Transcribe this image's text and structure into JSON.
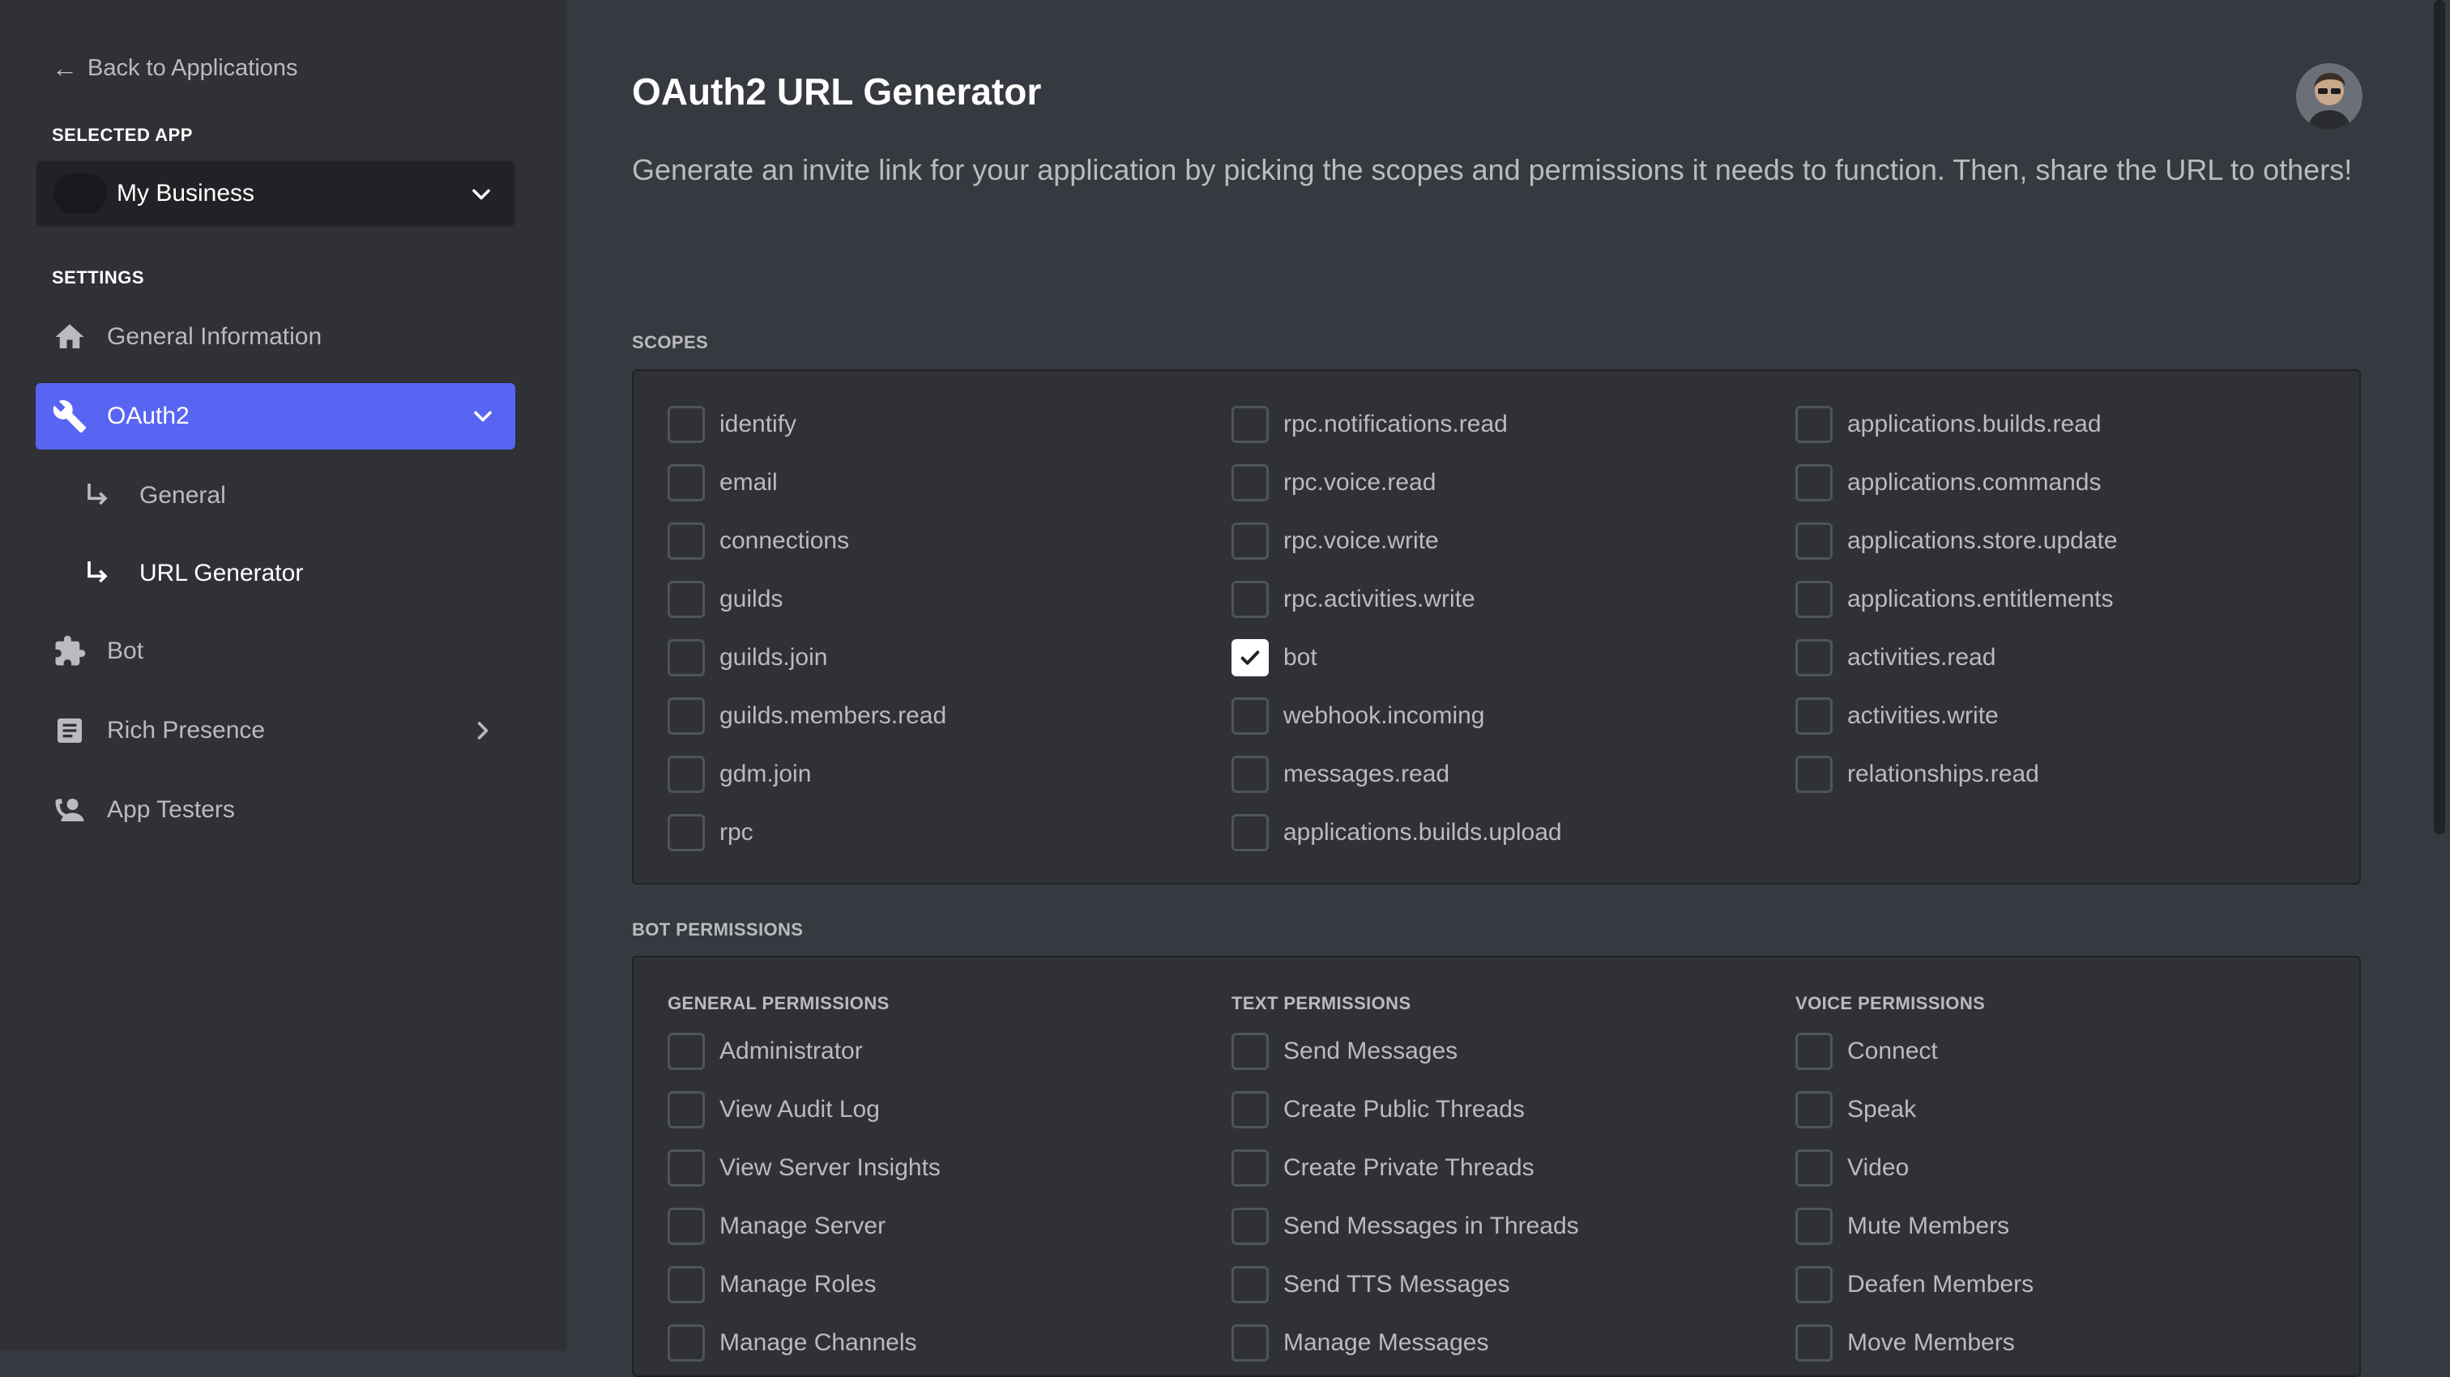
{
  "sidebar": {
    "back_label": "Back to Applications",
    "selected_app_label": "Selected App",
    "selected_app_name": "My Business",
    "settings_label": "Settings",
    "items": [
      {
        "label": "General Information",
        "icon": "home-icon"
      },
      {
        "label": "OAuth2",
        "icon": "wrench-icon",
        "active": true
      },
      {
        "label": "Bot",
        "icon": "puzzle-icon"
      },
      {
        "label": "Rich Presence",
        "icon": "document-icon"
      },
      {
        "label": "App Testers",
        "icon": "person-phone-icon"
      }
    ],
    "oauth_sub": [
      {
        "label": "General"
      },
      {
        "label": "URL Generator",
        "current": true
      }
    ]
  },
  "main": {
    "title": "OAuth2 URL Generator",
    "description": "Generate an invite link for your application by picking the scopes and permissions it needs to function. Then, share the URL to others!",
    "scopes_label": "Scopes",
    "scopes": {
      "col1": [
        "identify",
        "email",
        "connections",
        "guilds",
        "guilds.join",
        "guilds.members.read",
        "gdm.join",
        "rpc"
      ],
      "col2": [
        "rpc.notifications.read",
        "rpc.voice.read",
        "rpc.voice.write",
        "rpc.activities.write",
        "bot",
        "webhook.incoming",
        "messages.read",
        "applications.builds.upload"
      ],
      "col3": [
        "applications.builds.read",
        "applications.commands",
        "applications.store.update",
        "applications.entitlements",
        "activities.read",
        "activities.write",
        "relationships.read"
      ],
      "checked": [
        "bot"
      ]
    },
    "bot_permissions_label": "Bot Permissions",
    "permissions": {
      "general_label": "General Permissions",
      "text_label": "Text Permissions",
      "voice_label": "Voice Permissions",
      "general": [
        "Administrator",
        "View Audit Log",
        "View Server Insights",
        "Manage Server",
        "Manage Roles",
        "Manage Channels"
      ],
      "text": [
        "Send Messages",
        "Create Public Threads",
        "Create Private Threads",
        "Send Messages in Threads",
        "Send TTS Messages",
        "Manage Messages"
      ],
      "voice": [
        "Connect",
        "Speak",
        "Video",
        "Mute Members",
        "Deafen Members",
        "Move Members"
      ]
    }
  },
  "colors": {
    "accent": "#5865f2",
    "background": "#36393f",
    "sidebar": "#2f3136"
  }
}
